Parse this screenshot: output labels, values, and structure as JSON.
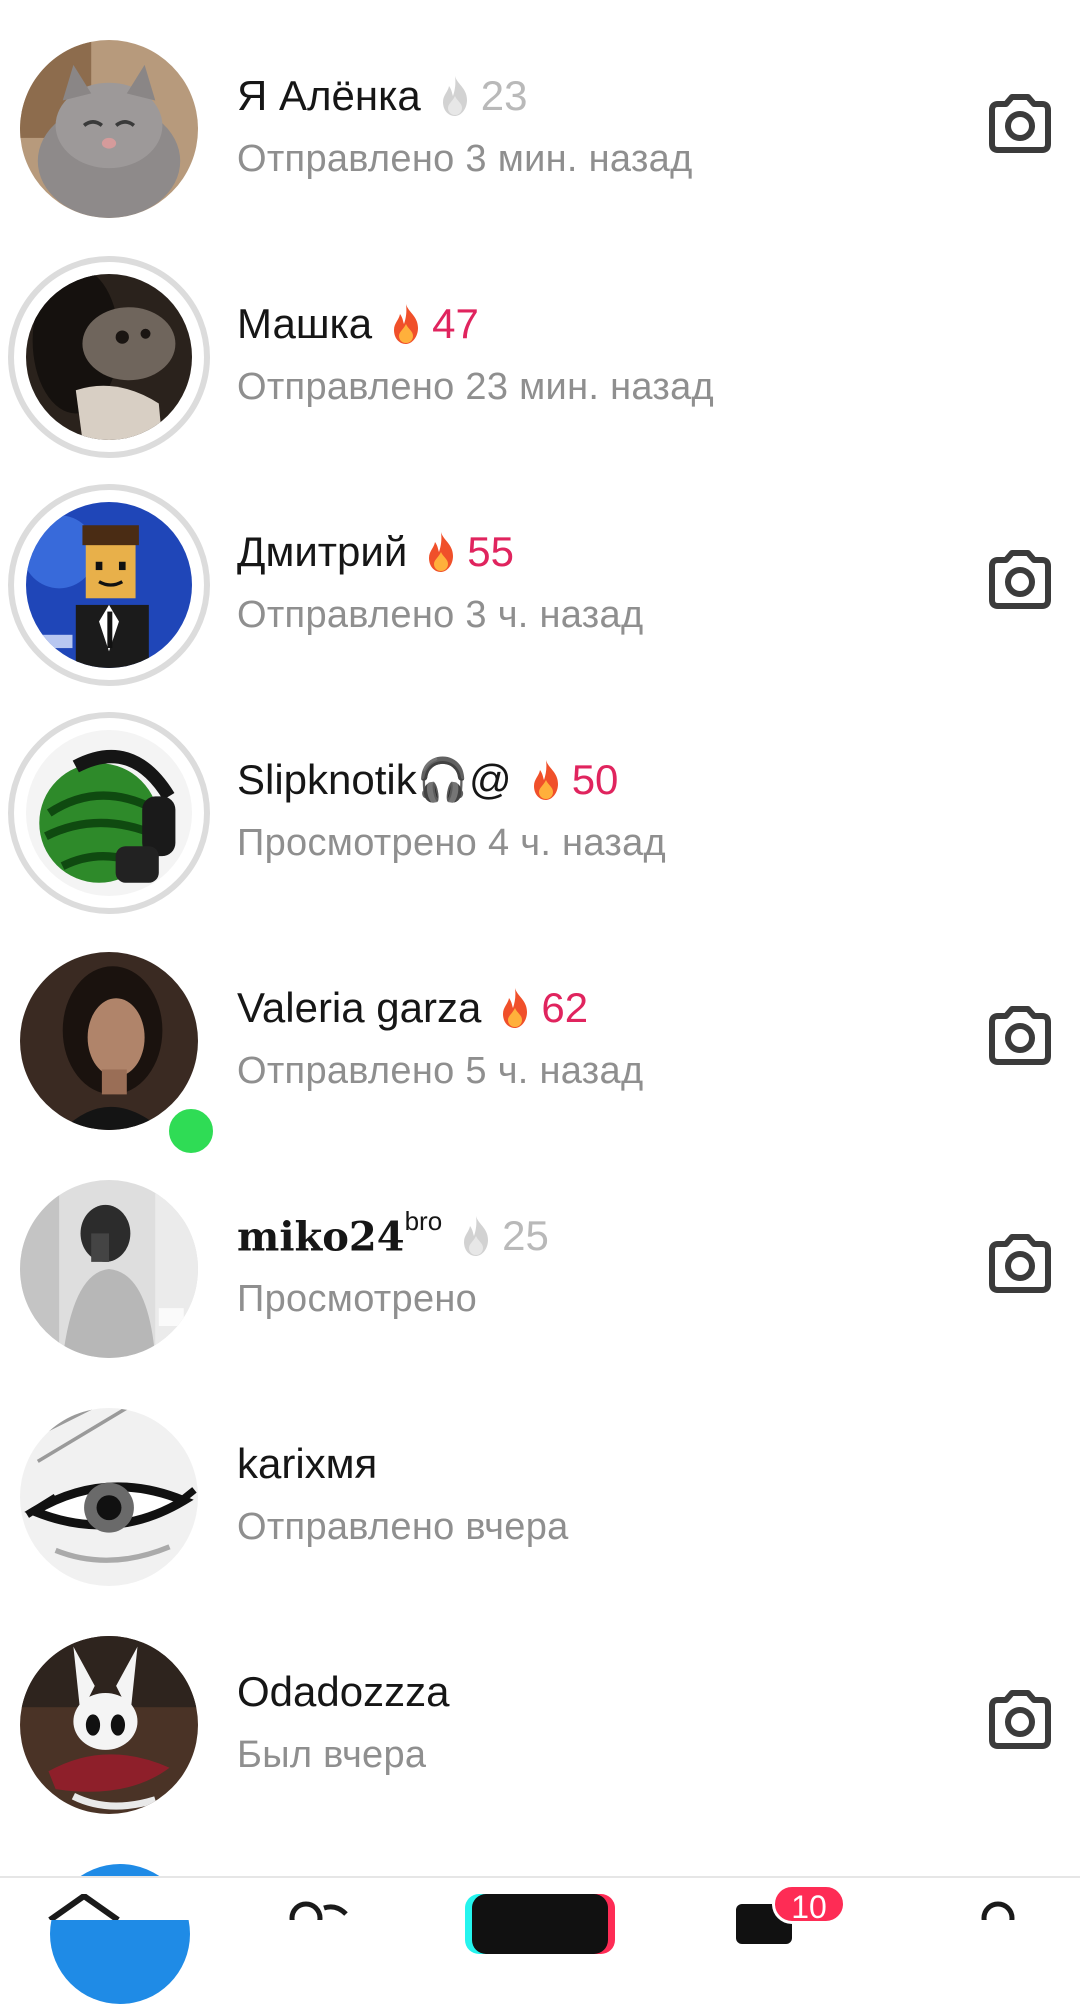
{
  "chats": [
    {
      "name": "Я Алёнка",
      "name_sup": "",
      "streak": "23",
      "streak_state": "faded",
      "status": "Отправлено 3 мин. назад",
      "story_ring": false,
      "online": false,
      "camera": true,
      "avatar": "cat"
    },
    {
      "name": "Машка",
      "name_sup": "",
      "streak": "47",
      "streak_state": "active",
      "status": "Отправлено 23 мин. назад",
      "story_ring": true,
      "online": false,
      "camera": false,
      "avatar": "dark-animal"
    },
    {
      "name": "Дмитрий",
      "name_sup": "",
      "streak": "55",
      "streak_state": "active",
      "status": "Отправлено 3 ч. назад",
      "story_ring": true,
      "online": false,
      "camera": true,
      "avatar": "roblox-suit"
    },
    {
      "name": "Slipknotik🎧@",
      "name_sup": "",
      "streak": "50",
      "streak_state": "active",
      "status": "Просмотрено 4 ч. назад",
      "story_ring": true,
      "online": false,
      "camera": false,
      "avatar": "watermelon-headphones"
    },
    {
      "name": "Valeria garza",
      "name_sup": "",
      "streak": "62",
      "streak_state": "active",
      "status": "Отправлено 5 ч. назад",
      "story_ring": false,
      "online": true,
      "camera": true,
      "avatar": "woman-portrait"
    },
    {
      "name": "miko24",
      "name_sup": "bro",
      "streak": "25",
      "streak_state": "faded",
      "status": "Просмотрено",
      "story_ring": false,
      "online": false,
      "camera": true,
      "avatar": "mirror-selfie"
    },
    {
      "name": "karixмя",
      "name_sup": "",
      "streak": "",
      "streak_state": "none",
      "status": "Отправлено вчера",
      "story_ring": false,
      "online": false,
      "camera": false,
      "avatar": "anime-eye"
    },
    {
      "name": "Odadozzza",
      "name_sup": "",
      "streak": "",
      "streak_state": "none",
      "status": "Был вчера",
      "story_ring": false,
      "online": false,
      "camera": true,
      "avatar": "hollow-knight"
    }
  ],
  "bottom_nav": {
    "items": [
      "home-icon",
      "friends-icon",
      "create-icon",
      "inbox-icon",
      "profile-icon"
    ],
    "inbox_badge": "10"
  },
  "colors": {
    "streak_active": "#e0245e",
    "streak_faded": "#b9b9b9",
    "status_text": "#8f8f8f",
    "online": "#2fdc55",
    "badge": "#fe2c55"
  }
}
